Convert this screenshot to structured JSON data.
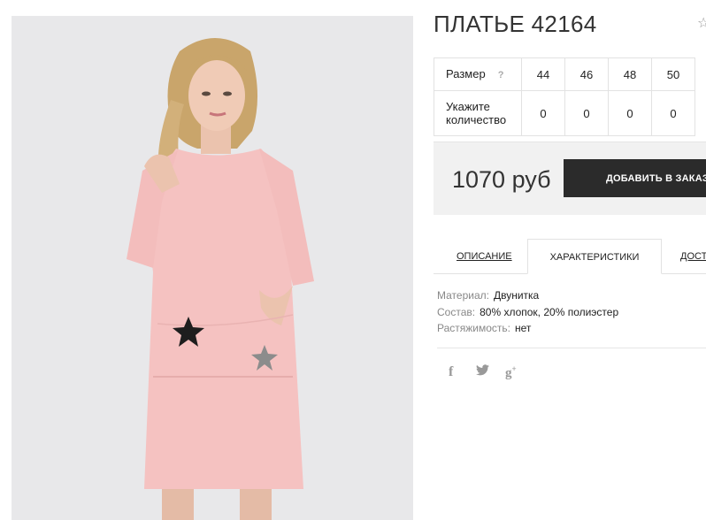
{
  "product": {
    "title": "ПЛАТЬЕ 42164"
  },
  "size_table": {
    "size_label": "Размер",
    "help_icon": "?",
    "sizes": [
      "44",
      "46",
      "48",
      "50"
    ],
    "qty_label": "Укажите количество",
    "quantities": [
      "0",
      "0",
      "0",
      "0"
    ]
  },
  "buy": {
    "price": "1070 руб",
    "cart_button_label": "ДОБАВИТЬ В ЗАКАЗ"
  },
  "tabs": [
    {
      "label": "ОПИСАНИЕ"
    },
    {
      "label": "ХАРАКТЕРИСТИКИ",
      "active": true
    },
    {
      "label": "ДОСТАВКА"
    }
  ],
  "specs": [
    {
      "key": "Материал:",
      "value": "Двунитка"
    },
    {
      "key": "Состав:",
      "value": "80% хлопок, 20% полиэстер"
    },
    {
      "key": "Растяжимость:",
      "value": "нет"
    }
  ],
  "social": {
    "facebook": "f",
    "twitter": "🐦",
    "googleplus": "g+"
  },
  "icons": [
    "star-favorite-icon",
    "help-icon",
    "shopping-bag-icon",
    "facebook-icon",
    "twitter-icon",
    "google-plus-icon"
  ],
  "colors": {
    "dress": "#f5c2c1",
    "button": "#2b2b2b",
    "buy_box": "#f1f1f1"
  }
}
